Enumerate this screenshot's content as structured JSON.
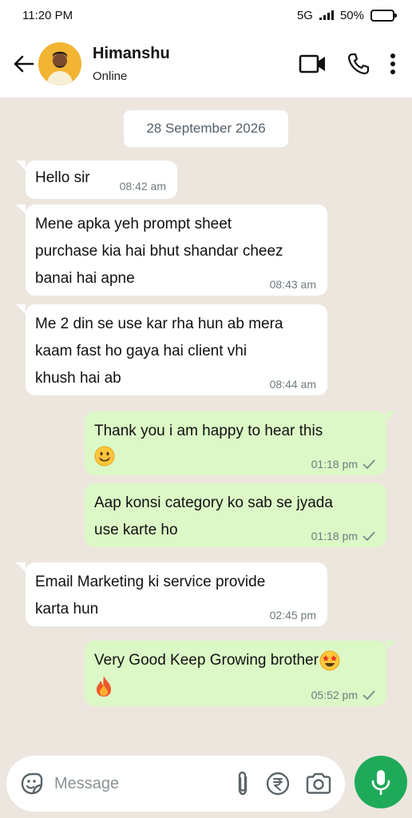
{
  "status_bar": {
    "time": "11:20 PM",
    "network": "5G",
    "battery": "50%",
    "battery_level": 0.5
  },
  "header": {
    "contact_name": "Himanshu",
    "contact_status": "Online",
    "icons": [
      "back-arrow-icon",
      "video-call-icon",
      "phone-call-icon",
      "more-options-icon"
    ]
  },
  "chat": {
    "date_chip": "28 September 2026",
    "messages": [
      {
        "direction": "in",
        "lines": [
          "Hello sir"
        ],
        "time": "08:42 am"
      },
      {
        "direction": "in",
        "lines": [
          "Mene apka yeh prompt sheet",
          "purchase kia hai bhut shandar cheez",
          "banai hai apne"
        ],
        "time": "08:43 am"
      },
      {
        "direction": "in",
        "lines": [
          "Me 2 din se use kar rha hun ab mera",
          "kaam fast ho gaya hai client vhi",
          "khush hai ab"
        ],
        "time": "08:44 am"
      },
      {
        "direction": "out",
        "lines": [
          "Thank you i am happy to hear this"
        ],
        "emoji": "smiling-face-emoji",
        "time": "01:18 pm",
        "read": true
      },
      {
        "direction": "out",
        "lines": [
          "Aap konsi category ko sab se jyada",
          "use karte ho"
        ],
        "time": "01:18 pm",
        "read": true
      },
      {
        "direction": "in",
        "lines": [
          "Email Marketing ki service provide",
          "karta hun"
        ],
        "time": "02:45 pm"
      },
      {
        "direction": "out",
        "lines": [
          "Very Good Keep Growing brother"
        ],
        "emoji_inline": "star-struck-emoji",
        "emoji": "fire-emoji",
        "time": "05:52 pm",
        "read": true
      }
    ]
  },
  "composer": {
    "placeholder": "Message",
    "icons": [
      "sticker-icon",
      "attach-icon",
      "rupee-payment-icon",
      "camera-icon",
      "mic-icon"
    ]
  },
  "colors": {
    "chat_background": "#ece6de",
    "outgoing_bubble": "#dcf8c6",
    "incoming_bubble": "#ffffff",
    "mic_button": "#1faa5a",
    "timestamp": "#6f7a80"
  }
}
